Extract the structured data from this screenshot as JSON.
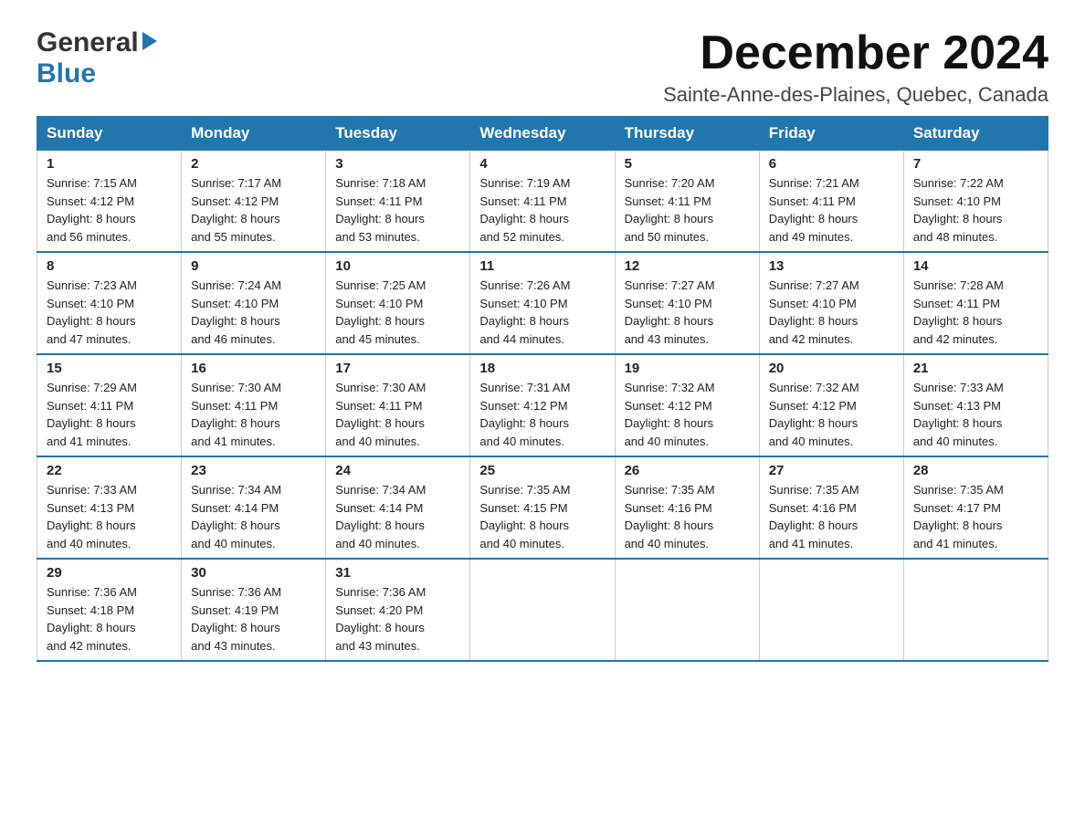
{
  "header": {
    "logo_general": "General",
    "logo_blue": "Blue",
    "month_year": "December 2024",
    "location": "Sainte-Anne-des-Plaines, Quebec, Canada"
  },
  "days_of_week": [
    "Sunday",
    "Monday",
    "Tuesday",
    "Wednesday",
    "Thursday",
    "Friday",
    "Saturday"
  ],
  "weeks": [
    [
      {
        "day": "1",
        "sunrise": "7:15 AM",
        "sunset": "4:12 PM",
        "daylight": "8 hours and 56 minutes."
      },
      {
        "day": "2",
        "sunrise": "7:17 AM",
        "sunset": "4:12 PM",
        "daylight": "8 hours and 55 minutes."
      },
      {
        "day": "3",
        "sunrise": "7:18 AM",
        "sunset": "4:11 PM",
        "daylight": "8 hours and 53 minutes."
      },
      {
        "day": "4",
        "sunrise": "7:19 AM",
        "sunset": "4:11 PM",
        "daylight": "8 hours and 52 minutes."
      },
      {
        "day": "5",
        "sunrise": "7:20 AM",
        "sunset": "4:11 PM",
        "daylight": "8 hours and 50 minutes."
      },
      {
        "day": "6",
        "sunrise": "7:21 AM",
        "sunset": "4:11 PM",
        "daylight": "8 hours and 49 minutes."
      },
      {
        "day": "7",
        "sunrise": "7:22 AM",
        "sunset": "4:10 PM",
        "daylight": "8 hours and 48 minutes."
      }
    ],
    [
      {
        "day": "8",
        "sunrise": "7:23 AM",
        "sunset": "4:10 PM",
        "daylight": "8 hours and 47 minutes."
      },
      {
        "day": "9",
        "sunrise": "7:24 AM",
        "sunset": "4:10 PM",
        "daylight": "8 hours and 46 minutes."
      },
      {
        "day": "10",
        "sunrise": "7:25 AM",
        "sunset": "4:10 PM",
        "daylight": "8 hours and 45 minutes."
      },
      {
        "day": "11",
        "sunrise": "7:26 AM",
        "sunset": "4:10 PM",
        "daylight": "8 hours and 44 minutes."
      },
      {
        "day": "12",
        "sunrise": "7:27 AM",
        "sunset": "4:10 PM",
        "daylight": "8 hours and 43 minutes."
      },
      {
        "day": "13",
        "sunrise": "7:27 AM",
        "sunset": "4:10 PM",
        "daylight": "8 hours and 42 minutes."
      },
      {
        "day": "14",
        "sunrise": "7:28 AM",
        "sunset": "4:11 PM",
        "daylight": "8 hours and 42 minutes."
      }
    ],
    [
      {
        "day": "15",
        "sunrise": "7:29 AM",
        "sunset": "4:11 PM",
        "daylight": "8 hours and 41 minutes."
      },
      {
        "day": "16",
        "sunrise": "7:30 AM",
        "sunset": "4:11 PM",
        "daylight": "8 hours and 41 minutes."
      },
      {
        "day": "17",
        "sunrise": "7:30 AM",
        "sunset": "4:11 PM",
        "daylight": "8 hours and 40 minutes."
      },
      {
        "day": "18",
        "sunrise": "7:31 AM",
        "sunset": "4:12 PM",
        "daylight": "8 hours and 40 minutes."
      },
      {
        "day": "19",
        "sunrise": "7:32 AM",
        "sunset": "4:12 PM",
        "daylight": "8 hours and 40 minutes."
      },
      {
        "day": "20",
        "sunrise": "7:32 AM",
        "sunset": "4:12 PM",
        "daylight": "8 hours and 40 minutes."
      },
      {
        "day": "21",
        "sunrise": "7:33 AM",
        "sunset": "4:13 PM",
        "daylight": "8 hours and 40 minutes."
      }
    ],
    [
      {
        "day": "22",
        "sunrise": "7:33 AM",
        "sunset": "4:13 PM",
        "daylight": "8 hours and 40 minutes."
      },
      {
        "day": "23",
        "sunrise": "7:34 AM",
        "sunset": "4:14 PM",
        "daylight": "8 hours and 40 minutes."
      },
      {
        "day": "24",
        "sunrise": "7:34 AM",
        "sunset": "4:14 PM",
        "daylight": "8 hours and 40 minutes."
      },
      {
        "day": "25",
        "sunrise": "7:35 AM",
        "sunset": "4:15 PM",
        "daylight": "8 hours and 40 minutes."
      },
      {
        "day": "26",
        "sunrise": "7:35 AM",
        "sunset": "4:16 PM",
        "daylight": "8 hours and 40 minutes."
      },
      {
        "day": "27",
        "sunrise": "7:35 AM",
        "sunset": "4:16 PM",
        "daylight": "8 hours and 41 minutes."
      },
      {
        "day": "28",
        "sunrise": "7:35 AM",
        "sunset": "4:17 PM",
        "daylight": "8 hours and 41 minutes."
      }
    ],
    [
      {
        "day": "29",
        "sunrise": "7:36 AM",
        "sunset": "4:18 PM",
        "daylight": "8 hours and 42 minutes."
      },
      {
        "day": "30",
        "sunrise": "7:36 AM",
        "sunset": "4:19 PM",
        "daylight": "8 hours and 43 minutes."
      },
      {
        "day": "31",
        "sunrise": "7:36 AM",
        "sunset": "4:20 PM",
        "daylight": "8 hours and 43 minutes."
      },
      null,
      null,
      null,
      null
    ]
  ],
  "labels": {
    "sunrise": "Sunrise:",
    "sunset": "Sunset:",
    "daylight": "Daylight:"
  }
}
